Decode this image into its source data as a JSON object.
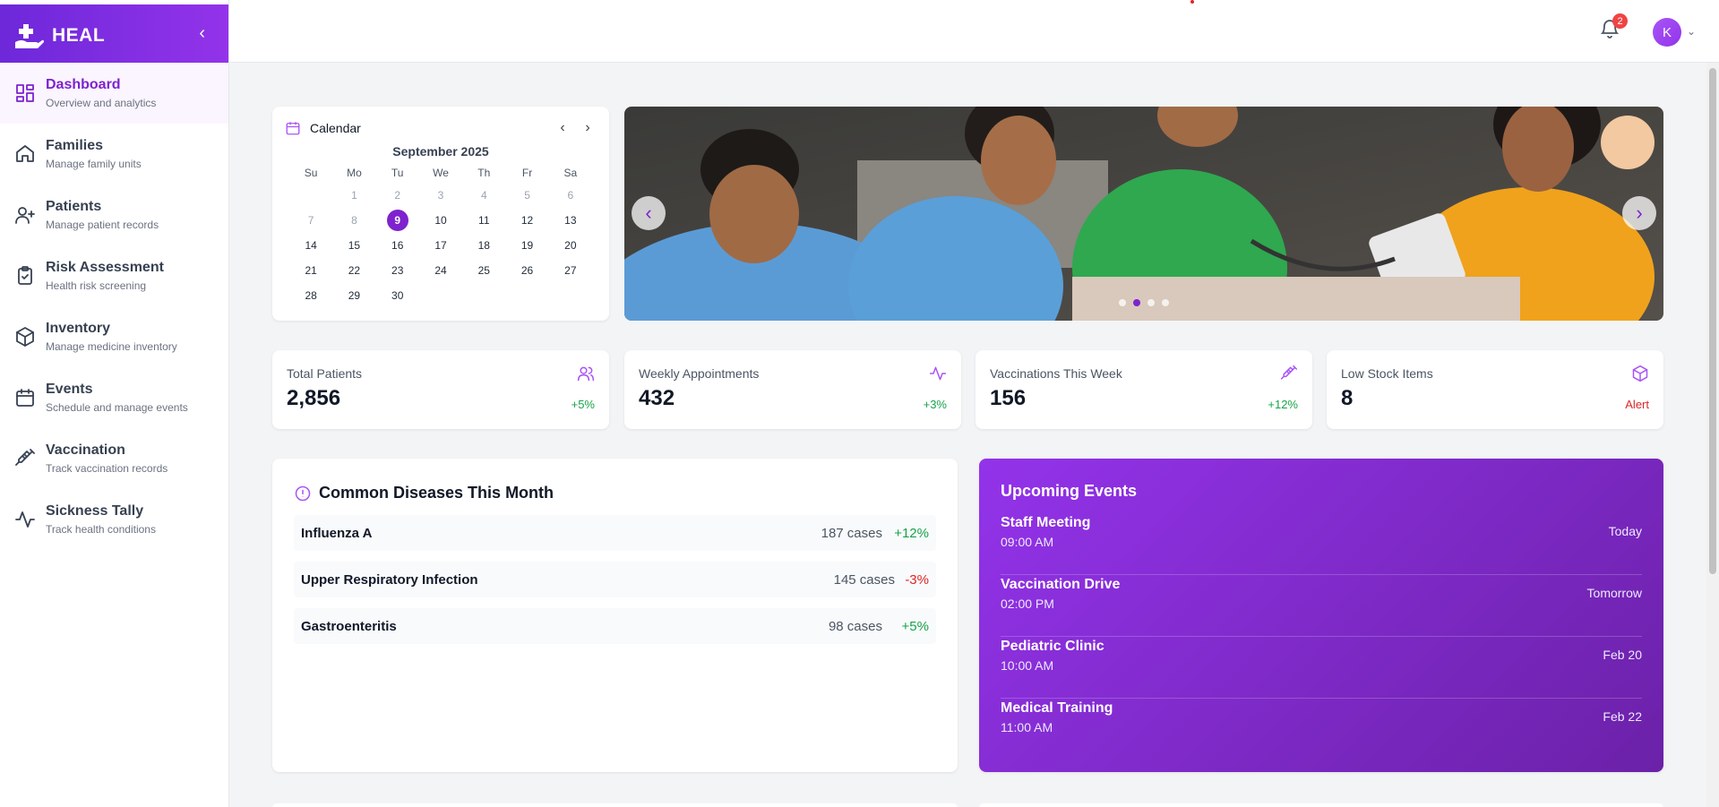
{
  "brand": {
    "name": "HEAL",
    "collapse_icon": "chevron-left-icon"
  },
  "nav": [
    {
      "label": "Dashboard",
      "sub": "Overview and analytics",
      "icon": "dashboard-icon",
      "active": true
    },
    {
      "label": "Families",
      "sub": "Manage family units",
      "icon": "home-icon"
    },
    {
      "label": "Patients",
      "sub": "Manage patient records",
      "icon": "user-plus-icon"
    },
    {
      "label": "Risk Assessment",
      "sub": "Health risk screening",
      "icon": "clipboard-check-icon"
    },
    {
      "label": "Inventory",
      "sub": "Manage medicine inventory",
      "icon": "package-icon"
    },
    {
      "label": "Events",
      "sub": "Schedule and manage events",
      "icon": "calendar-icon"
    },
    {
      "label": "Vaccination",
      "sub": "Track vaccination records",
      "icon": "syringe-icon"
    },
    {
      "label": "Sickness Tally",
      "sub": "Track health conditions",
      "icon": "activity-icon"
    }
  ],
  "topbar": {
    "notifications": "2",
    "avatar_initial": "K"
  },
  "calendar": {
    "title": "Calendar",
    "month": "September 2025",
    "dow": [
      "Su",
      "Mo",
      "Tu",
      "We",
      "Th",
      "Fr",
      "Sa"
    ],
    "days": [
      "",
      "1",
      "2",
      "3",
      "4",
      "5",
      "6",
      "7",
      "8",
      "9",
      "10",
      "11",
      "12",
      "13",
      "14",
      "15",
      "16",
      "17",
      "18",
      "19",
      "20",
      "21",
      "22",
      "23",
      "24",
      "25",
      "26",
      "27",
      "28",
      "29",
      "30"
    ],
    "muted_days": [
      "1",
      "2",
      "3",
      "4",
      "5",
      "6",
      "7",
      "8"
    ],
    "today": "9"
  },
  "carousel": {
    "slides": 4,
    "active_slide": 2
  },
  "stats": [
    {
      "label": "Total Patients",
      "value": "2,856",
      "change": "+5%",
      "icon": "users-icon"
    },
    {
      "label": "Weekly Appointments",
      "value": "432",
      "change": "+3%",
      "icon": "activity-icon"
    },
    {
      "label": "Vaccinations This Week",
      "value": "156",
      "change": "+12%",
      "icon": "syringe-icon"
    },
    {
      "label": "Low Stock Items",
      "value": "8",
      "change": "Alert",
      "icon": "package-icon"
    }
  ],
  "diseases": {
    "title": "Common Diseases This Month",
    "rows": [
      {
        "name": "Influenza A",
        "cases": "187 cases",
        "change": "+12%"
      },
      {
        "name": "Upper Respiratory Infection",
        "cases": "145 cases",
        "change": "-3%"
      },
      {
        "name": "Gastroenteritis",
        "cases": "98 cases",
        "change": "+5%"
      }
    ]
  },
  "events": {
    "title": "Upcoming Events",
    "items": [
      {
        "name": "Staff Meeting",
        "time": "09:00 AM",
        "when": "Today"
      },
      {
        "name": "Vaccination Drive",
        "time": "02:00 PM",
        "when": "Tomorrow"
      },
      {
        "name": "Pediatric Clinic",
        "time": "10:00 AM",
        "when": "Feb 20"
      },
      {
        "name": "Medical Training",
        "time": "11:00 AM",
        "when": "Feb 22"
      }
    ]
  },
  "colors": {
    "accent": "#7e22ce",
    "brand_gradient_start": "#6d28d9",
    "brand_gradient_end": "#9333ea",
    "positive": "#16a34a",
    "negative": "#dc2626"
  }
}
